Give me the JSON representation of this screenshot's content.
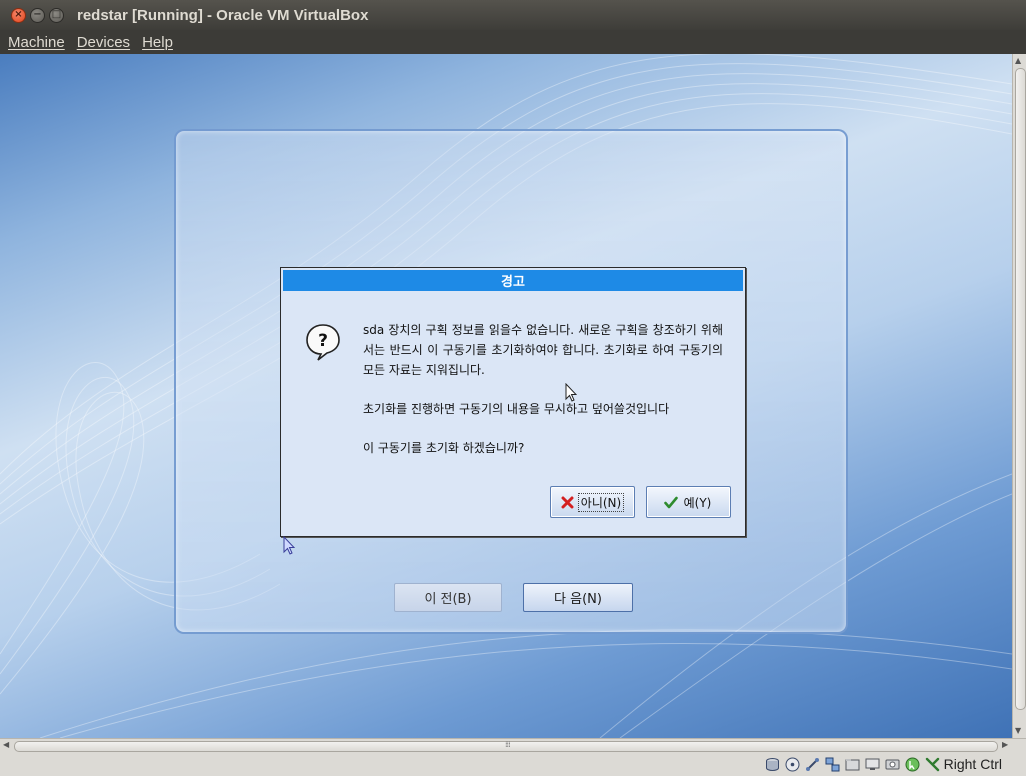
{
  "window": {
    "title": "redstar [Running] - Oracle VM VirtualBox",
    "buttons": {
      "close": "×",
      "minimize": "−",
      "maximize": "□"
    }
  },
  "menubar": {
    "items": [
      "Machine",
      "Devices",
      "Help"
    ]
  },
  "installer": {
    "prev_label": "이 전(B)",
    "next_label": "다 음(N)"
  },
  "dialog": {
    "title": "경고",
    "icon": "question-icon",
    "paragraph1": "sda 장치의 구획 정보를 읽을수 없습니다. 새로운 구획을 창조하기 위해서는 반드시 이 구동기를 초기화하여야 합니다. 초기화로 하여 구동기의 모든 자료는 지워집니다.",
    "paragraph2": "초기화를 진행하면 구동기의 내용을 무시하고 덮어쓸것입니다",
    "paragraph3": "이 구동기를 초기화 하겠습니까?",
    "no_label": "아니(N)",
    "yes_label": "예(Y)"
  },
  "statusbar": {
    "icons": [
      "hard-disk-icon",
      "optical-drive-icon",
      "usb-icon",
      "network-icon",
      "shared-folder-icon",
      "display-icon",
      "capture-icon",
      "mouse-integration-icon",
      "keyboard-icon"
    ],
    "host_key": "Right Ctrl"
  },
  "colors": {
    "dialog_title_bg": "#1e8ae6",
    "dialog_bg": "#dbe6f6",
    "host_chrome": "#3c3b37"
  }
}
